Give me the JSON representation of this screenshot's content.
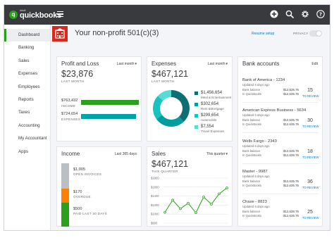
{
  "brand": {
    "intuit": "intuit",
    "name": "quickbooks",
    "accent": "#2ca01c"
  },
  "topbar": {
    "bg": "#393a3d",
    "icons": [
      "plus-icon",
      "search-icon",
      "gear-icon",
      "help-icon"
    ]
  },
  "sidebar": {
    "items": [
      {
        "label": "Dashboard",
        "active": true
      },
      {
        "label": "Banking"
      },
      {
        "label": "Sales"
      },
      {
        "label": "Expenses"
      },
      {
        "label": "Employees"
      },
      {
        "label": "Reports"
      },
      {
        "label": "Taxes"
      },
      {
        "label": "Accounting"
      },
      {
        "label": "My Accountant"
      },
      {
        "label": "Apps"
      }
    ]
  },
  "company": {
    "name": "Your non-profit 501(c)(3)",
    "resume_setup": "Resume setup",
    "privacy": "PRIVACY"
  },
  "profit_loss": {
    "title": "Profit and Loss",
    "period": "Last month",
    "net": "$23,876",
    "net_label": "LAST MONTH",
    "income_amount": "$763,432",
    "income_label": "INCOME",
    "expenses_amount": "$724,654",
    "expenses_label": "EXPENSES",
    "income_color": "#2ca01c",
    "expenses_color": "#00a4a7"
  },
  "expenses": {
    "title": "Expenses",
    "period": "Last month",
    "total": "$467,121",
    "total_label": "LAST MONTH",
    "legend": [
      {
        "amount": "$1,456,654",
        "name": "Meal & Entertainment",
        "color": "#0d6f73",
        "share": 0.38
      },
      {
        "amount": "$302,654",
        "name": "Rent &Mortgage",
        "color": "#009da0",
        "share": 0.27
      },
      {
        "amount": "$299,654",
        "name": "Automobile",
        "color": "#19c1bf",
        "share": 0.22
      },
      {
        "amount": "$7,554",
        "name": "Travel Expenses",
        "color": "#56dbd7",
        "share": 0.13
      }
    ]
  },
  "bank": {
    "title": "Bank accounts",
    "edit": "Edit",
    "balance_label": "Bank balance",
    "qb_label": "In QuickBooks",
    "review_label": "TO REVIEW",
    "accounts": [
      {
        "name": "Bank of America - 1234",
        "updated": "Updated 6 days ago",
        "bank_balance": "$12,635.76",
        "qb_balance": "$12,635.76",
        "count": "15"
      },
      {
        "name": "American Express Business - 5634",
        "updated": "Updated 6 days ago",
        "bank_balance": "$12,635.76",
        "qb_balance": "$12,635.76",
        "count": "30"
      },
      {
        "name": "Wells Fargo - 2343",
        "updated": "Updated 6 days ago",
        "bank_balance": "$12,635.76",
        "qb_balance": "$12,635.76",
        "count": "18"
      },
      {
        "name": "Master - 9987",
        "updated": "Updated 6 days ago",
        "bank_balance": "$12,635.76",
        "qb_balance": "$12,635.76",
        "count": "36"
      },
      {
        "name": "Chase - 8823",
        "updated": "Updated 6 days ago",
        "bank_balance": "$12,635.76",
        "qb_balance": "$12,635.76",
        "count": "25"
      }
    ]
  },
  "income": {
    "title": "Income",
    "period": "Last 365 days",
    "rows": [
      {
        "amount": "$1,005",
        "label": "OPEN INVOICES",
        "color": "#babec5"
      },
      {
        "amount": "$170",
        "label": "OVERDUE",
        "color": "#ff8000"
      },
      {
        "amount": "$500",
        "label": "PAID LAST 30 DAYS",
        "color": "#2ca01c"
      }
    ]
  },
  "sales": {
    "title": "Sales",
    "period": "This quarter",
    "total": "$467,121",
    "total_label": "THIS QUARTER",
    "line_color": "#2ca01c",
    "chart_data": {
      "type": "line",
      "title": "",
      "xlabel": "",
      "ylabel": "",
      "y_ticks": [
        "$1800",
        "$1600",
        "$1400",
        "$1200",
        "$1000",
        "$800"
      ],
      "ylim": [
        800,
        1800
      ],
      "values": [
        1040,
        1310,
        1120,
        1240,
        1030,
        1380,
        1220,
        1450,
        1580
      ]
    }
  }
}
